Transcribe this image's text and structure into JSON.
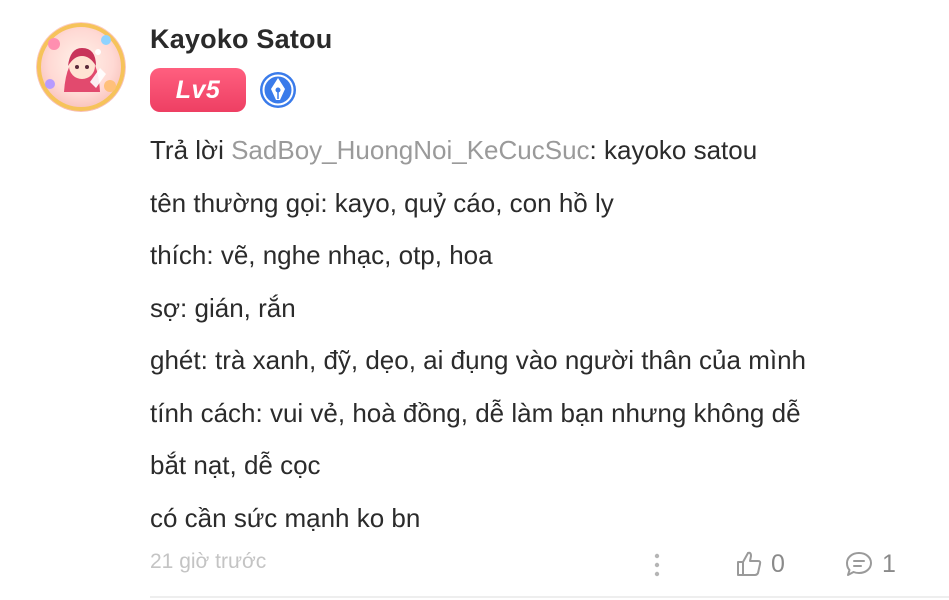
{
  "author": {
    "name": "Kayoko Satou",
    "level": "Lv5",
    "avatar": "anime-girl-avatar",
    "badge_icon": "pen-nib-icon"
  },
  "comment": {
    "reply_prefix": "Trả lời ",
    "reply_target": "SadBoy_HuongNoi_KeCucSuc",
    "reply_rest": ": kayoko satou",
    "lines": [
      "tên thường gọi: kayo, quỷ cáo, con hồ ly",
      "thích: vẽ, nghe nhạc, otp, hoa",
      "sợ: gián, rắn",
      "ghét: trà xanh, đỹ, dẹo, ai đụng vào người thân của mình",
      "tính cách: vui vẻ, hoà đồng, dễ làm bạn nhưng không dễ",
      "bắt nạt, dễ cọc",
      "có cần sức mạnh ko bn"
    ]
  },
  "footer": {
    "timestamp": "21 giờ trước",
    "like_count": "0",
    "comment_count": "1",
    "more_icon": "more-vertical-icon",
    "like_icon": "thumbs-up-icon",
    "comment_icon": "comment-bubble-icon"
  },
  "colors": {
    "level_badge": "#ee3f63",
    "reply_target": "#9a9a9a",
    "writer_badge": "#3a7bea",
    "timestamp": "#c4c4c4"
  }
}
